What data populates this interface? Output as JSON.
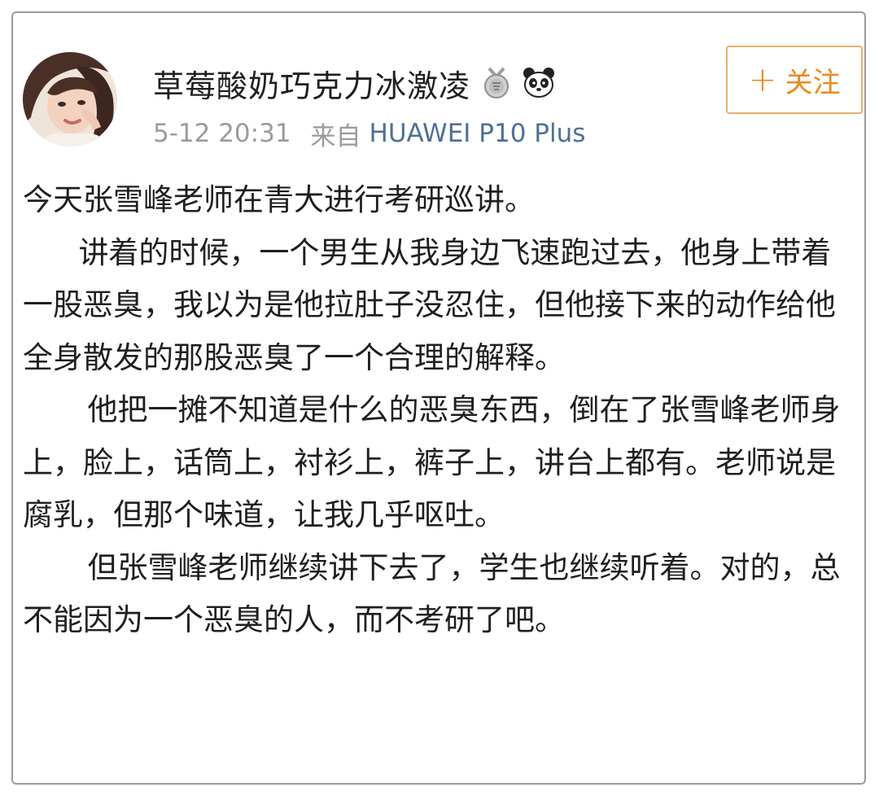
{
  "post_header": {
    "username": "草莓酸奶巧克力冰激凌",
    "time": "5-12 20:31",
    "source_prefix": "来自",
    "device": "HUAWEI P10 Plus"
  },
  "follow_button": {
    "plus": "+",
    "label": "关注"
  },
  "post_body": {
    "paragraphs": [
      "今天张雪峰老师在青大进行考研巡讲。",
      "讲着的时候，一个男生从我身边飞速跑过去，他身上带着一股恶臭，我以为是他拉肚子没忍住，但他接下来的动作给他全身散发的那股恶臭了一个合理的解释。",
      "他把一摊不知道是什么的恶臭东西，倒在了张雪峰老师身上，脸上，话筒上，衬衫上，裤子上，讲台上都有。老师说是腐乳，但那个味道，让我几乎呕吐。",
      "但张雪峰老师继续讲下去了，学生也继续听着。对的，总不能因为一个恶臭的人，而不考研了吧。"
    ]
  },
  "colors": {
    "follow_accent": "#e88a1e",
    "follow_border": "#ecb06a",
    "device_link": "#4f6f95",
    "meta_gray": "#9b9b9b"
  },
  "icons": {
    "badge_1": "medal-icon",
    "badge_2": "panda-icon"
  }
}
